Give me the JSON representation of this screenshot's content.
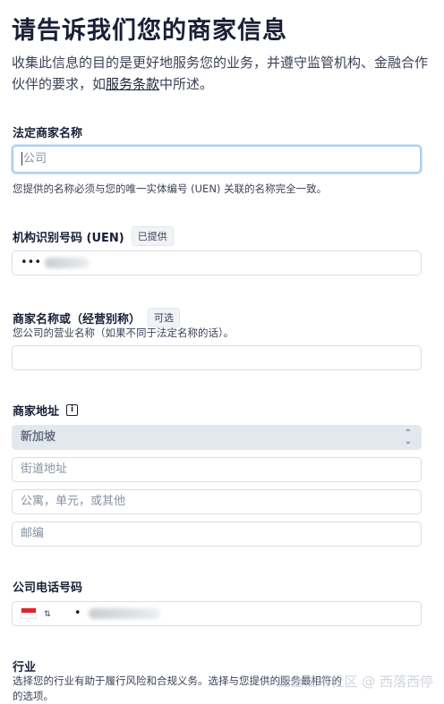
{
  "page": {
    "title": "请告诉我们您的商家信息",
    "intro_before": "收集此信息的目的是更好地服务您的业务，并遵守监管机构、金融合作伙伴的要求，如",
    "intro_link": "服务条款",
    "intro_after": "中所述。"
  },
  "legal_name": {
    "label": "法定商家名称",
    "placeholder": "公司",
    "help": "您提供的名称必须与您的唯一实体编号 (UEN) 关联的名称完全一致。"
  },
  "uen": {
    "label": "机构识别号码 (UEN)",
    "badge": "已提供",
    "masked_value": "•••"
  },
  "dba": {
    "label": "商家名称或（经营别称）",
    "badge": "可选",
    "help": "您公司的营业名称（如果不同于法定名称的话）。"
  },
  "address": {
    "label": "商家地址",
    "country": "新加坡",
    "street_placeholder": "街道地址",
    "unit_placeholder": "公寓，单元，或其他",
    "postal_placeholder": "邮编"
  },
  "phone": {
    "label": "公司电话号码",
    "country_flag": "singapore-flag",
    "masked_value": "•"
  },
  "industry": {
    "label": "行业",
    "help": "选择您的行业有助于履行风险和合规义务。选择与您提供的服务最相符的",
    "help_cont": "的选项。"
  },
  "watermark": "掘金技术社区 @ 西落西停"
}
